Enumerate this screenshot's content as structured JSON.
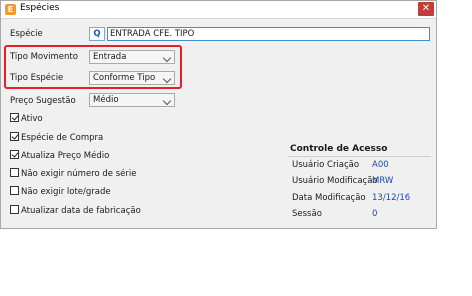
{
  "window": {
    "title": "Espécies",
    "close_symbol": "✕",
    "app_icon_glyph": "E"
  },
  "form": {
    "especie": {
      "label": "Espécie",
      "lookup_glyph": "Q",
      "value": "ENTRADA CFE. TIPO"
    },
    "tipo_movimento": {
      "label": "Tipo Movimento",
      "value": "Entrada"
    },
    "tipo_especie": {
      "label": "Tipo Espécie",
      "value": "Conforme Tipo"
    },
    "preco_sugestao": {
      "label": "Preço Sugestão",
      "value": "Médio"
    }
  },
  "checkboxes": [
    {
      "label": "Ativo",
      "checked": true
    },
    {
      "label": "Espécie de Compra",
      "checked": true
    },
    {
      "label": "Atualiza Preço Médio",
      "checked": true
    },
    {
      "label": "Não exigir número de série",
      "checked": false
    },
    {
      "label": "Não exigir lote/grade",
      "checked": false
    },
    {
      "label": "Atualizar data de fabricação",
      "checked": false
    }
  ],
  "controle_acesso": {
    "title": "Controle de Acesso",
    "rows": [
      {
        "label": "Usuário Criação",
        "value": "A00"
      },
      {
        "label": "Usuário Modificação",
        "value": "MRW"
      },
      {
        "label": "Data Modificação",
        "value": "13/12/16"
      },
      {
        "label": "Sessão",
        "value": "0"
      }
    ]
  },
  "colors": {
    "highlight_border": "#e0202a",
    "field_focus_border": "#3d8fd1",
    "value_text": "#1c4aa0",
    "app_icon": "#f39a2b"
  }
}
